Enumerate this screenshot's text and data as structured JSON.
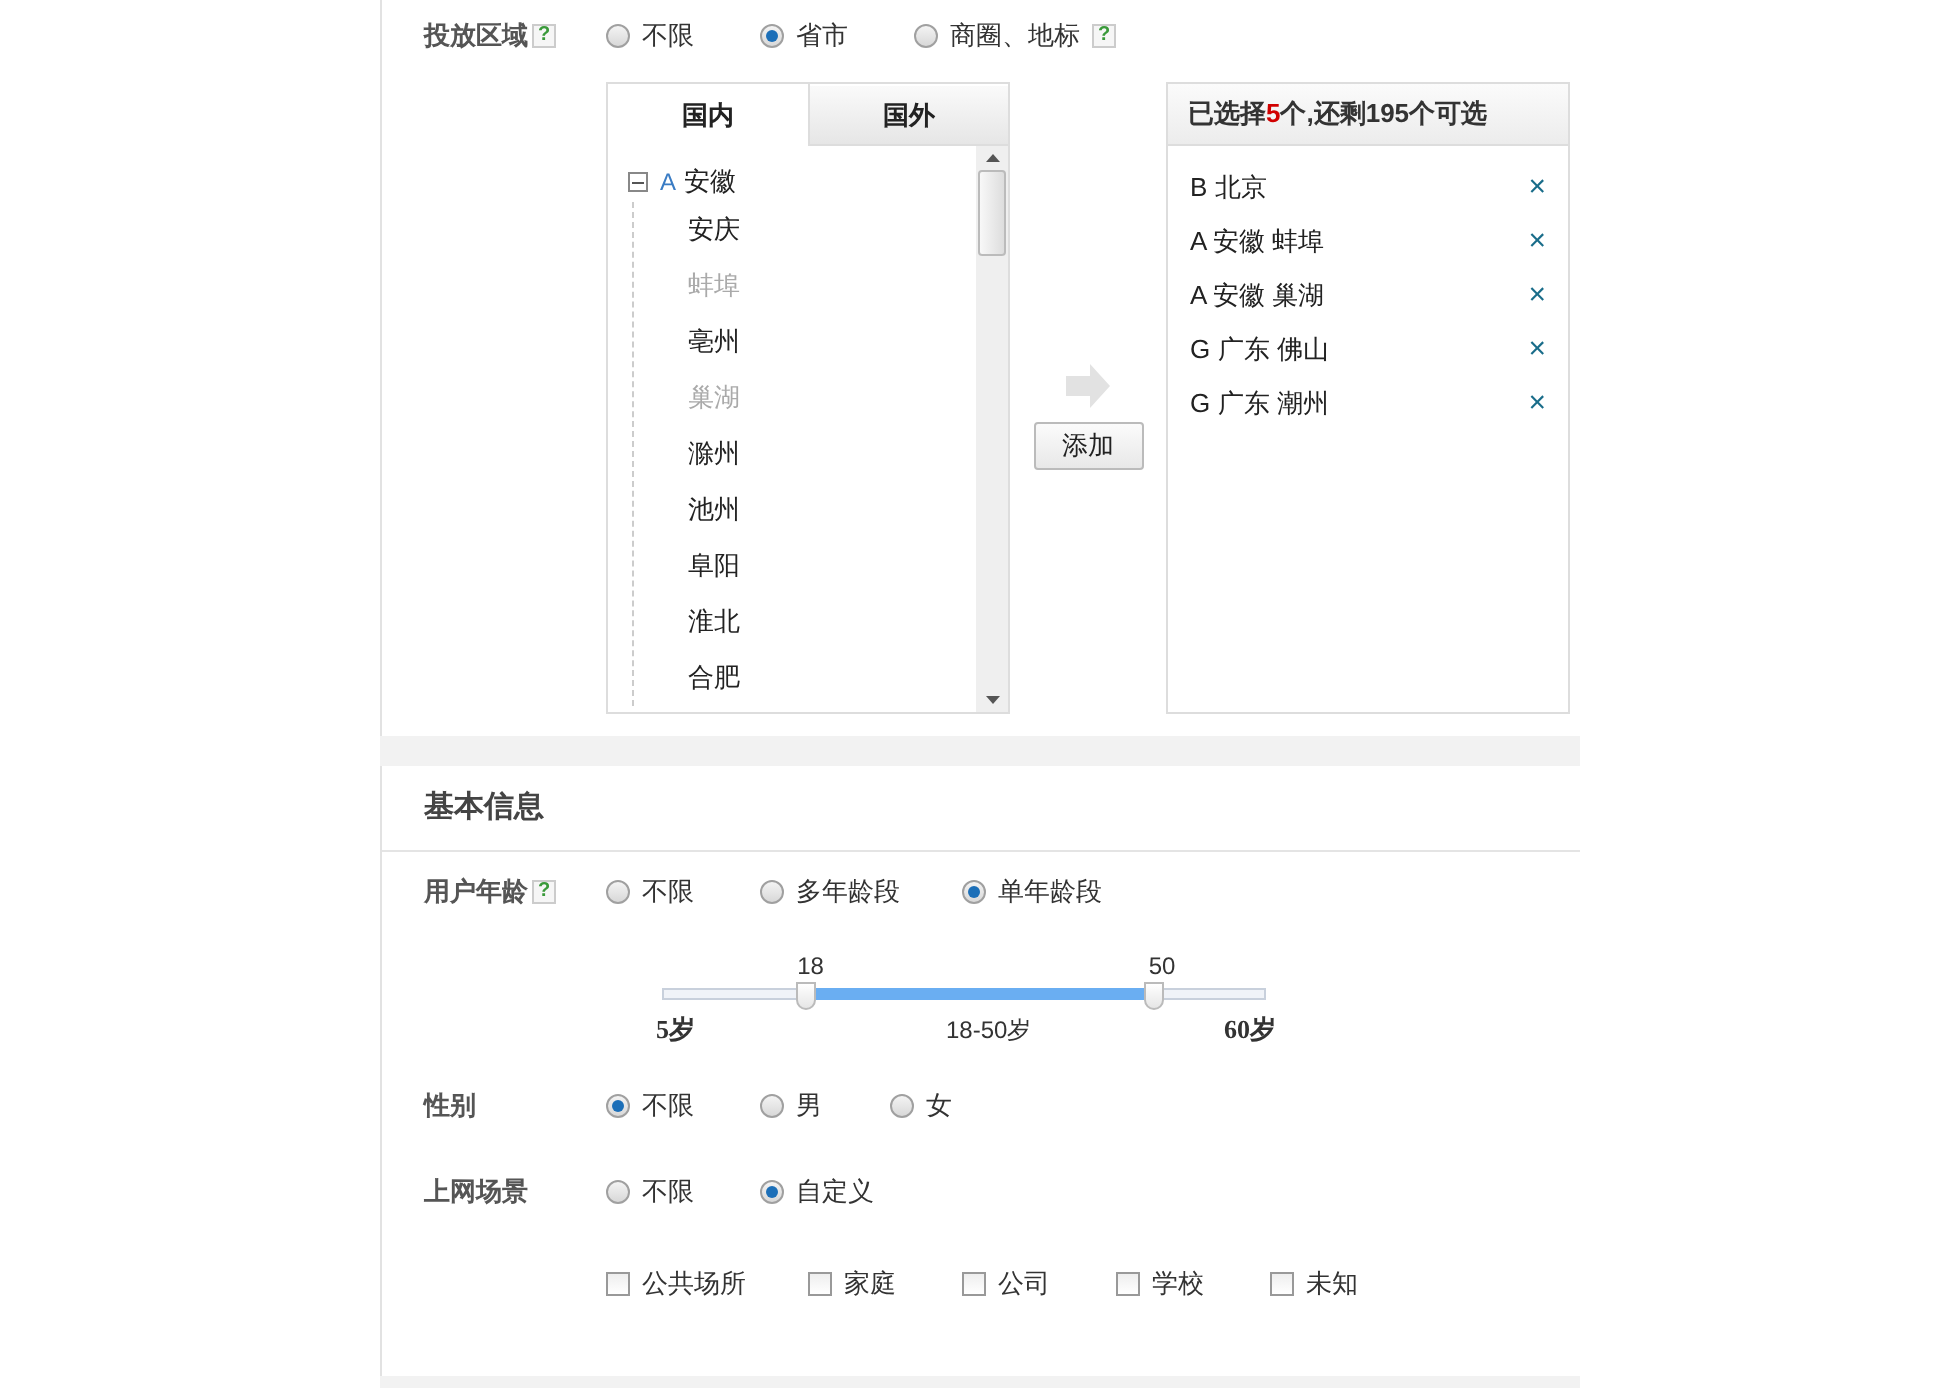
{
  "region": {
    "label": "投放区域",
    "help": "?",
    "options": [
      {
        "label": "不限",
        "selected": false
      },
      {
        "label": "省市",
        "selected": true
      },
      {
        "label": "商圈、地标",
        "selected": false,
        "help": "?"
      }
    ],
    "tabs": [
      {
        "label": "国内",
        "selected": true
      },
      {
        "label": "国外",
        "selected": false
      }
    ],
    "tree": {
      "letter": "A",
      "name": "安徽",
      "expanded": true,
      "children": [
        {
          "name": "安庆",
          "disabled": false
        },
        {
          "name": "蚌埠",
          "disabled": true
        },
        {
          "name": "亳州",
          "disabled": false
        },
        {
          "name": "巢湖",
          "disabled": true
        },
        {
          "name": "滁州",
          "disabled": false
        },
        {
          "name": "池州",
          "disabled": false
        },
        {
          "name": "阜阳",
          "disabled": false
        },
        {
          "name": "淮北",
          "disabled": false
        },
        {
          "name": "合肥",
          "disabled": false
        }
      ]
    },
    "add_button": "添加",
    "selected_header": {
      "prefix": "已选择",
      "count": "5",
      "suffix": "个,还剩195个可选"
    },
    "selected_items": [
      {
        "letter": "B",
        "name": "北京"
      },
      {
        "letter": "A",
        "name": "安徽 蚌埠"
      },
      {
        "letter": "A",
        "name": "安徽 巢湖"
      },
      {
        "letter": "G",
        "name": "广东 佛山"
      },
      {
        "letter": "G",
        "name": "广东 潮州"
      }
    ],
    "remove_icon": "×"
  },
  "basic_info": {
    "title": "基本信息",
    "age": {
      "label": "用户年龄",
      "help": "?",
      "options": [
        {
          "label": "不限",
          "selected": false
        },
        {
          "label": "多年龄段",
          "selected": false
        },
        {
          "label": "单年龄段",
          "selected": true
        }
      ],
      "slider": {
        "handles": [
          {
            "label": "18",
            "level": 0.236
          },
          {
            "label": "50",
            "level": 0.818
          }
        ],
        "min_label": "5岁",
        "range_label": "18-50岁",
        "max_label": "60岁"
      }
    },
    "gender": {
      "label": "性别",
      "options": [
        {
          "label": "不限",
          "selected": true
        },
        {
          "label": "男",
          "selected": false
        },
        {
          "label": "女",
          "selected": false
        }
      ]
    },
    "scene": {
      "label": "上网场景",
      "options": [
        {
          "label": "不限",
          "selected": false
        },
        {
          "label": "自定义",
          "selected": true
        }
      ],
      "checkboxes": [
        {
          "label": "公共场所",
          "checked": false
        },
        {
          "label": "家庭",
          "checked": false
        },
        {
          "label": "公司",
          "checked": false
        },
        {
          "label": "学校",
          "checked": false
        },
        {
          "label": "未知",
          "checked": false
        }
      ]
    }
  }
}
